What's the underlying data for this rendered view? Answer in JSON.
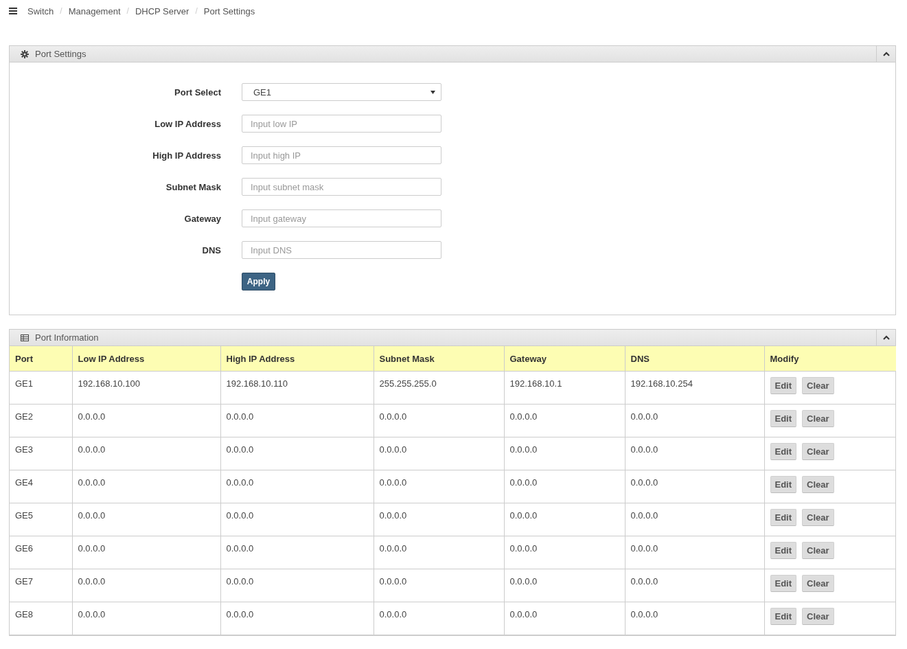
{
  "breadcrumb": [
    "Switch",
    "Management",
    "DHCP Server",
    "Port Settings"
  ],
  "breadcrumb_separator": "/",
  "settings_panel": {
    "title": "Port Settings",
    "fields": [
      {
        "kind": "select",
        "label": "Port Select",
        "value": "GE1"
      },
      {
        "kind": "input",
        "label": "Low IP Address",
        "placeholder": "Input low IP"
      },
      {
        "kind": "input",
        "label": "High IP Address",
        "placeholder": "Input high IP"
      },
      {
        "kind": "input",
        "label": "Subnet Mask",
        "placeholder": "Input subnet mask"
      },
      {
        "kind": "input",
        "label": "Gateway",
        "placeholder": "Input gateway"
      },
      {
        "kind": "input",
        "label": "DNS",
        "placeholder": "Input DNS"
      }
    ],
    "apply_button": "Apply"
  },
  "info_panel": {
    "title": "Port Information",
    "table": {
      "columns": [
        "Port",
        "Low IP Address",
        "High IP Address",
        "Subnet Mask",
        "Gateway",
        "DNS",
        "Modify"
      ],
      "rows": [
        {
          "cells": [
            "GE1",
            "192.168.10.100",
            "192.168.10.110",
            "255.255.255.0",
            "192.168.10.1",
            "192.168.10.254"
          ],
          "buttons": [
            "Edit",
            "Clear"
          ]
        },
        {
          "cells": [
            "GE2",
            "0.0.0.0",
            "0.0.0.0",
            "0.0.0.0",
            "0.0.0.0",
            "0.0.0.0"
          ],
          "buttons": [
            "Edit",
            "Clear"
          ]
        },
        {
          "cells": [
            "GE3",
            "0.0.0.0",
            "0.0.0.0",
            "0.0.0.0",
            "0.0.0.0",
            "0.0.0.0"
          ],
          "buttons": [
            "Edit",
            "Clear"
          ]
        },
        {
          "cells": [
            "GE4",
            "0.0.0.0",
            "0.0.0.0",
            "0.0.0.0",
            "0.0.0.0",
            "0.0.0.0"
          ],
          "buttons": [
            "Edit",
            "Clear"
          ]
        },
        {
          "cells": [
            "GE5",
            "0.0.0.0",
            "0.0.0.0",
            "0.0.0.0",
            "0.0.0.0",
            "0.0.0.0"
          ],
          "buttons": [
            "Edit",
            "Clear"
          ]
        },
        {
          "cells": [
            "GE6",
            "0.0.0.0",
            "0.0.0.0",
            "0.0.0.0",
            "0.0.0.0",
            "0.0.0.0"
          ],
          "buttons": [
            "Edit",
            "Clear"
          ]
        },
        {
          "cells": [
            "GE7",
            "0.0.0.0",
            "0.0.0.0",
            "0.0.0.0",
            "0.0.0.0",
            "0.0.0.0"
          ],
          "buttons": [
            "Edit",
            "Clear"
          ]
        },
        {
          "cells": [
            "GE8",
            "0.0.0.0",
            "0.0.0.0",
            "0.0.0.0",
            "0.0.0.0",
            "0.0.0.0"
          ],
          "buttons": [
            "Edit",
            "Clear"
          ]
        }
      ]
    }
  }
}
